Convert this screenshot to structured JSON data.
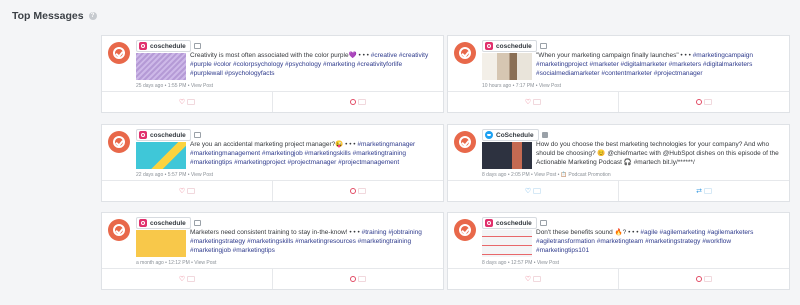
{
  "page": {
    "title": "Top Messages",
    "help": "?"
  },
  "colors": {
    "brand": "#e8684a",
    "instagram": "#e1306c",
    "twitter": "#1da1f2",
    "hashtag": "#2e3a8c"
  },
  "cards": [
    {
      "network": "instagram",
      "account": "coschedule",
      "type_icon": "image-icon",
      "text_plain": "Creativity is most often associated with the color purple💜 • • • ",
      "text_tags": "#creative #creativity #purple #color #colorpsychology #psychology #marketing #creativityforlife #purplewall #psychologyfacts",
      "meta": "25 days ago • 1:55 PM • View Post"
    },
    {
      "network": "instagram",
      "account": "coschedule",
      "type_icon": "image-icon",
      "text_plain": "\"When your marketing campaign finally launches\" • • • ",
      "text_tags": "#marketingcampaign #marketingproject #marketer #digitalmarketer #marketers #digitalmarketers #socialmediamarketer #contentmarketer #projectmanager",
      "meta": "10 hours ago • 7:17 PM • View Post"
    },
    {
      "network": "instagram",
      "account": "coschedule",
      "type_icon": "image-icon",
      "text_plain": "Are you an accidental marketing project manager?😜 • • • ",
      "text_tags": "#marketingmanager #marketingmanagement #marketingjob #marketingskills #marketingtraining #marketingtips #marketingproject #projectmanager #projectmanagement",
      "meta": "22 days ago • 5:57 PM • View Post"
    },
    {
      "network": "twitter",
      "account": "CoSchedule",
      "type_icon": "video-icon",
      "text_plain": "How do you choose the best marketing technologies for your company? And who should be choosing? 😊 @chiefmartec with @HubSpot dishes on this episode of the Actionable Marketing Podcast 🎧 #martech bit.ly/******/",
      "text_tags": "",
      "meta": "8 days ago • 2:05 PM • View Post • 📋 Podcast Promotion"
    },
    {
      "network": "instagram",
      "account": "coschedule",
      "type_icon": "image-icon",
      "text_plain": "Marketers need consistent training to stay in-the-know! • • • ",
      "text_tags": "#training #jobtraining #marketingstrategy #marketingskills #marketingresources #marketingtraining #marketingjob #marketingtips",
      "meta": "a month ago • 12:12 PM • View Post"
    },
    {
      "network": "instagram",
      "account": "coschedule",
      "type_icon": "image-icon",
      "text_plain": "Don't these benefits sound 🔥? • • • ",
      "text_tags": "#agile #agilemarketing #agilemarketers #agiletransformation #marketingteam #marketingstrategy #workflow #marketingtips101",
      "meta": "8 days ago • 12:57 PM • View Post"
    }
  ]
}
